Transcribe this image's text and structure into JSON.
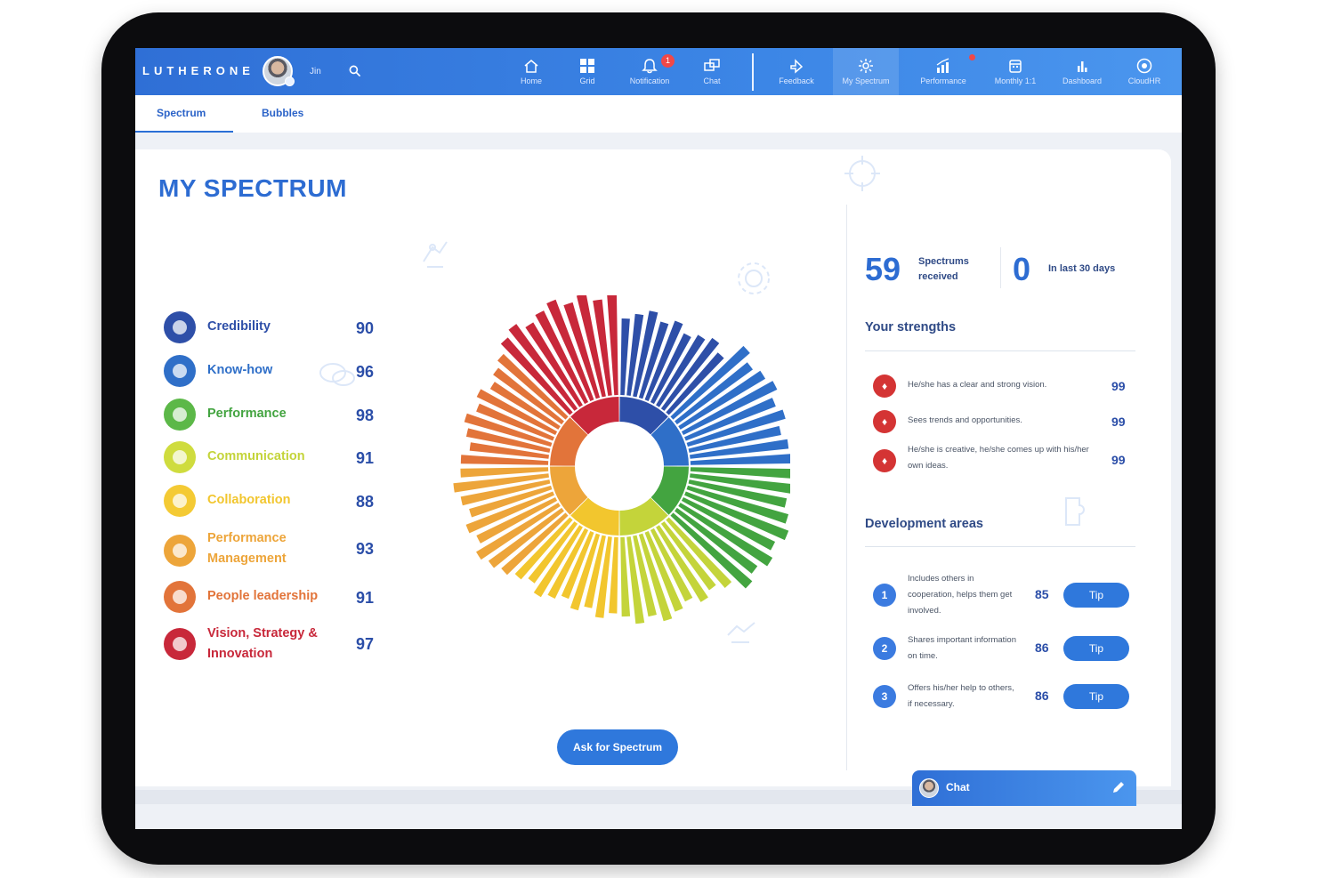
{
  "app": {
    "brand": "LUTHERONE",
    "user_name": "Jin"
  },
  "nav": [
    {
      "label": "Home",
      "icon": "home-icon",
      "badge": ""
    },
    {
      "label": "Grid",
      "icon": "grid-icon",
      "badge": ""
    },
    {
      "label": "Notification",
      "icon": "bell-icon",
      "badge": "1"
    },
    {
      "label": "Chat",
      "icon": "chat-icon",
      "badge": ""
    },
    {
      "label": "Feedback",
      "icon": "feedback-icon",
      "badge": ""
    },
    {
      "label": "My Spectrum",
      "icon": "spectrum-icon",
      "badge": ""
    },
    {
      "label": "Performance",
      "icon": "performance-icon",
      "badge": "dot"
    },
    {
      "label": "Monthly 1:1",
      "icon": "calendar-icon",
      "badge": ""
    },
    {
      "label": "Dashboard",
      "icon": "dashboard-icon",
      "badge": ""
    },
    {
      "label": "CloudHR",
      "icon": "cloud-icon",
      "badge": ""
    }
  ],
  "tabs": [
    {
      "label": "Spectrum",
      "active": true
    },
    {
      "label": "Bubbles",
      "active": false
    }
  ],
  "page_title": "MY SPECTRUM",
  "categories": [
    {
      "label": "Credibility",
      "value": 90,
      "color": "#2e4fa8"
    },
    {
      "label": "Know-how",
      "value": 96,
      "color": "#2f6fc8"
    },
    {
      "label": "Performance",
      "value": 98,
      "color": "#43a440"
    },
    {
      "label": "Communication",
      "value": 91,
      "color": "#c4d43a"
    },
    {
      "label": "Collaboration",
      "value": 88,
      "color": "#f2c62e"
    },
    {
      "label": "Performance Management",
      "value": 93,
      "color": "#eda53a"
    },
    {
      "label": "People leadership",
      "value": 91,
      "color": "#e2743a"
    },
    {
      "label": "Vision, Strategy & Innovation",
      "value": 97,
      "color": "#c8283a"
    }
  ],
  "ask_button": "Ask for Spectrum",
  "stats": {
    "received_count": "59",
    "received_label_1": "Spectrums",
    "received_label_2": "received",
    "recent_count": "0",
    "recent_label": "In last 30 days"
  },
  "strengths": {
    "title": "Your strengths",
    "items": [
      {
        "text": "He/she has a clear and strong vision.",
        "value": "99"
      },
      {
        "text": "Sees trends and opportunities.",
        "value": "99"
      },
      {
        "text": "He/she is creative, he/she comes up with his/her own ideas.",
        "value": "99"
      }
    ]
  },
  "development": {
    "title": "Development areas",
    "tip_label": "Tip",
    "items": [
      {
        "rank": "1",
        "text": "Includes others in cooperation, helps them get involved.",
        "value": "85"
      },
      {
        "rank": "2",
        "text": "Shares important information on time.",
        "value": "86"
      },
      {
        "rank": "3",
        "text": "Offers his/her help to others, if necessary.",
        "value": "86"
      }
    ]
  },
  "chat": {
    "label": "Chat"
  }
}
